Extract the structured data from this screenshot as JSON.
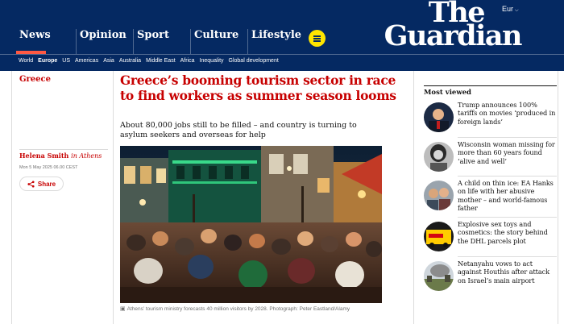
{
  "header": {
    "edition": "Eur",
    "logo_line1": "The",
    "logo_line2": "Guardian",
    "pillars": [
      "News",
      "Opinion",
      "Sport",
      "Culture",
      "Lifestyle"
    ],
    "accent_color": "#ff5943",
    "brand_color": "#052962"
  },
  "subnav": {
    "items": [
      "World",
      "Europe",
      "US",
      "Americas",
      "Asia",
      "Australia",
      "Middle East",
      "Africa",
      "Inequality",
      "Global development"
    ],
    "active": "Europe"
  },
  "article": {
    "section": "Greece",
    "headline": "Greece’s booming tourism sector in race to find workers as summer season looms",
    "standfirst": "About 80,000 jobs still to be filled – and country is turning to asylum seekers and overseas for help",
    "author": "Helena Smith",
    "author_location": "in Athens",
    "date": "Mon 5 May 2025 06.00 CEST",
    "share_label": "Share",
    "caption": "Athens’ tourism ministry forecasts 40 million visitors by 2028. Photograph: Peter Eastland/Alamy"
  },
  "most_viewed": {
    "title": "Most viewed",
    "items": [
      {
        "text": "Trump announces 100% tariffs on movies ‘produced in foreign lands’",
        "icon": "portrait-thumb"
      },
      {
        "text": "Wisconsin woman missing for more than 60 years found ‘alive and well’",
        "icon": "portrait-thumb"
      },
      {
        "text": "A child on thin ice: EA Hanks on life with her abusive mother – and world-famous father",
        "icon": "couple-thumb"
      },
      {
        "text": "Explosive sex toys and cosmetics: the story behind the DHL parcels plot",
        "icon": "van-thumb"
      },
      {
        "text": "Netanyahu vows to act against Houthis after attack on Israel’s main airport",
        "icon": "smoke-thumb"
      }
    ]
  }
}
